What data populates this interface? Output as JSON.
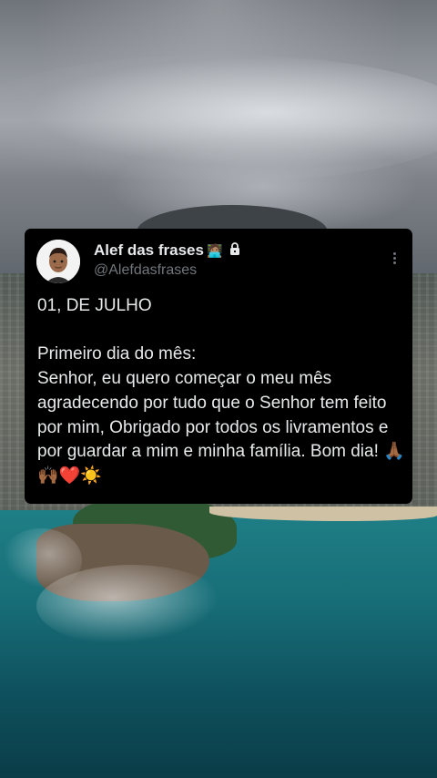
{
  "post": {
    "author_name": "Alef das frases",
    "name_emoji": "🧑🏽‍💻",
    "handle": "@Alefdasfrases",
    "text": "01, DE JULHO\n\nPrimeiro dia do mês:\nSenhor, eu quero começar o meu mês agradecendo por tudo que o Senhor tem feito por mim, Obrigado por todos os livramentos e por guardar a mim e minha família. Bom dia! 🙏🏾🙌🏾❤️☀️",
    "icons": {
      "avatar": "memoji-avatar",
      "lock": "lock-icon",
      "more": "more-vertical-icon"
    }
  },
  "colors": {
    "card_background": "#000000",
    "primary_text": "#e7e9ea",
    "secondary_text": "#71767b"
  }
}
